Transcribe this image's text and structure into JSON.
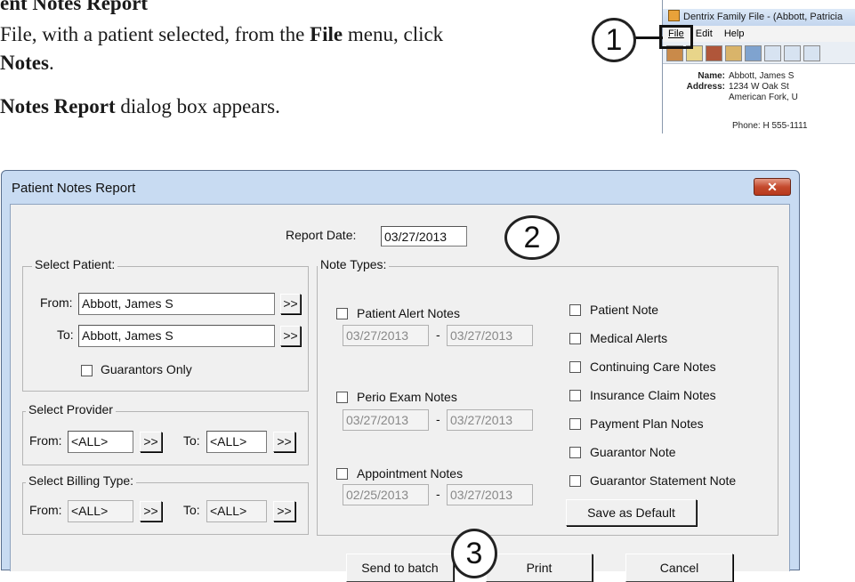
{
  "doc": {
    "heading": "ent Notes Report",
    "line1_pre": " File, with a patient selected, from the ",
    "line1_bold": "File",
    "line1_post": " menu, click",
    "line2_bold": "Notes",
    "line2_post": ".",
    "line3_bold": "Notes Report",
    "line3_post": " dialog box appears."
  },
  "mini_window": {
    "title": "Dentrix Family File - (Abbott, Patricia",
    "menu": [
      "File",
      "Edit",
      "Help"
    ],
    "name_label": "Name:",
    "name_value": "Abbott, James S",
    "address_label": "Address:",
    "address_line1": "1234 W Oak St",
    "address_line2": "American Fork, U",
    "phone": "Phone: H 555-1111"
  },
  "callouts": [
    "1",
    "2",
    "3"
  ],
  "dialog": {
    "title": "Patient Notes Report",
    "close_glyph": "✕",
    "report_date_label": "Report Date:",
    "report_date": "03/27/2013",
    "select_patient": {
      "label": "Select Patient:",
      "from_label": "From:",
      "from_value": "Abbott, James S",
      "to_label": "To:",
      "to_value": "Abbott, James S",
      "browse": ">>",
      "guarantors_only": "Guarantors Only"
    },
    "select_provider": {
      "label": "Select Provider",
      "from_label": "From:",
      "from_value": "<ALL>",
      "to_label": "To:",
      "to_value": "<ALL>",
      "browse": ">>"
    },
    "select_billing": {
      "label": "Select Billing Type:",
      "from_label": "From:",
      "from_value": "<ALL>",
      "to_label": "To:",
      "to_value": "<ALL>",
      "browse": ">>"
    },
    "note_types": {
      "label": "Note Types:",
      "patient_alert": "Patient Alert Notes",
      "patient_alert_from": "03/27/2013",
      "patient_alert_to": "03/27/2013",
      "perio_exam": "Perio Exam Notes",
      "perio_from": "03/27/2013",
      "perio_to": "03/27/2013",
      "appointment": "Appointment Notes",
      "appt_from": "02/25/2013",
      "appt_to": "03/27/2013",
      "dash": "-",
      "right_options": [
        "Patient Note",
        "Medical Alerts",
        "Continuing Care Notes",
        "Insurance Claim Notes",
        "Payment Plan Notes",
        "Guarantor Note",
        "Guarantor Statement Note"
      ],
      "save_default": "Save as Default"
    },
    "buttons": {
      "send_to_batch": "Send to batch",
      "print": "Print",
      "cancel": "Cancel"
    }
  }
}
